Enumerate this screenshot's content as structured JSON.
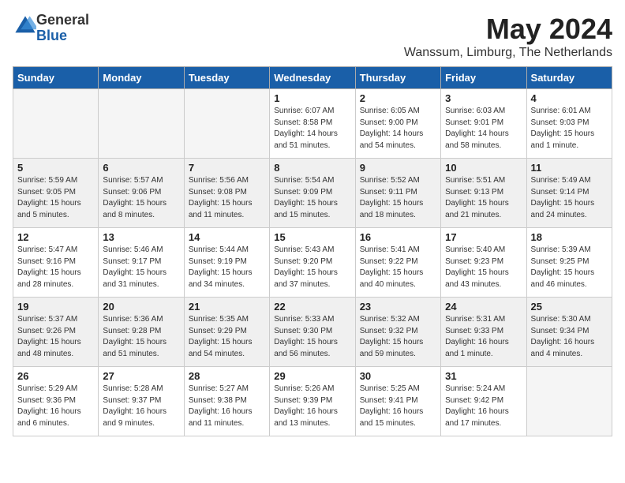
{
  "logo": {
    "general": "General",
    "blue": "Blue"
  },
  "header": {
    "month_title": "May 2024",
    "location": "Wanssum, Limburg, The Netherlands"
  },
  "weekdays": [
    "Sunday",
    "Monday",
    "Tuesday",
    "Wednesday",
    "Thursday",
    "Friday",
    "Saturday"
  ],
  "weeks": [
    [
      {
        "day": "",
        "info": ""
      },
      {
        "day": "",
        "info": ""
      },
      {
        "day": "",
        "info": ""
      },
      {
        "day": "1",
        "info": "Sunrise: 6:07 AM\nSunset: 8:58 PM\nDaylight: 14 hours\nand 51 minutes."
      },
      {
        "day": "2",
        "info": "Sunrise: 6:05 AM\nSunset: 9:00 PM\nDaylight: 14 hours\nand 54 minutes."
      },
      {
        "day": "3",
        "info": "Sunrise: 6:03 AM\nSunset: 9:01 PM\nDaylight: 14 hours\nand 58 minutes."
      },
      {
        "day": "4",
        "info": "Sunrise: 6:01 AM\nSunset: 9:03 PM\nDaylight: 15 hours\nand 1 minute."
      }
    ],
    [
      {
        "day": "5",
        "info": "Sunrise: 5:59 AM\nSunset: 9:05 PM\nDaylight: 15 hours\nand 5 minutes."
      },
      {
        "day": "6",
        "info": "Sunrise: 5:57 AM\nSunset: 9:06 PM\nDaylight: 15 hours\nand 8 minutes."
      },
      {
        "day": "7",
        "info": "Sunrise: 5:56 AM\nSunset: 9:08 PM\nDaylight: 15 hours\nand 11 minutes."
      },
      {
        "day": "8",
        "info": "Sunrise: 5:54 AM\nSunset: 9:09 PM\nDaylight: 15 hours\nand 15 minutes."
      },
      {
        "day": "9",
        "info": "Sunrise: 5:52 AM\nSunset: 9:11 PM\nDaylight: 15 hours\nand 18 minutes."
      },
      {
        "day": "10",
        "info": "Sunrise: 5:51 AM\nSunset: 9:13 PM\nDaylight: 15 hours\nand 21 minutes."
      },
      {
        "day": "11",
        "info": "Sunrise: 5:49 AM\nSunset: 9:14 PM\nDaylight: 15 hours\nand 24 minutes."
      }
    ],
    [
      {
        "day": "12",
        "info": "Sunrise: 5:47 AM\nSunset: 9:16 PM\nDaylight: 15 hours\nand 28 minutes."
      },
      {
        "day": "13",
        "info": "Sunrise: 5:46 AM\nSunset: 9:17 PM\nDaylight: 15 hours\nand 31 minutes."
      },
      {
        "day": "14",
        "info": "Sunrise: 5:44 AM\nSunset: 9:19 PM\nDaylight: 15 hours\nand 34 minutes."
      },
      {
        "day": "15",
        "info": "Sunrise: 5:43 AM\nSunset: 9:20 PM\nDaylight: 15 hours\nand 37 minutes."
      },
      {
        "day": "16",
        "info": "Sunrise: 5:41 AM\nSunset: 9:22 PM\nDaylight: 15 hours\nand 40 minutes."
      },
      {
        "day": "17",
        "info": "Sunrise: 5:40 AM\nSunset: 9:23 PM\nDaylight: 15 hours\nand 43 minutes."
      },
      {
        "day": "18",
        "info": "Sunrise: 5:39 AM\nSunset: 9:25 PM\nDaylight: 15 hours\nand 46 minutes."
      }
    ],
    [
      {
        "day": "19",
        "info": "Sunrise: 5:37 AM\nSunset: 9:26 PM\nDaylight: 15 hours\nand 48 minutes."
      },
      {
        "day": "20",
        "info": "Sunrise: 5:36 AM\nSunset: 9:28 PM\nDaylight: 15 hours\nand 51 minutes."
      },
      {
        "day": "21",
        "info": "Sunrise: 5:35 AM\nSunset: 9:29 PM\nDaylight: 15 hours\nand 54 minutes."
      },
      {
        "day": "22",
        "info": "Sunrise: 5:33 AM\nSunset: 9:30 PM\nDaylight: 15 hours\nand 56 minutes."
      },
      {
        "day": "23",
        "info": "Sunrise: 5:32 AM\nSunset: 9:32 PM\nDaylight: 15 hours\nand 59 minutes."
      },
      {
        "day": "24",
        "info": "Sunrise: 5:31 AM\nSunset: 9:33 PM\nDaylight: 16 hours\nand 1 minute."
      },
      {
        "day": "25",
        "info": "Sunrise: 5:30 AM\nSunset: 9:34 PM\nDaylight: 16 hours\nand 4 minutes."
      }
    ],
    [
      {
        "day": "26",
        "info": "Sunrise: 5:29 AM\nSunset: 9:36 PM\nDaylight: 16 hours\nand 6 minutes."
      },
      {
        "day": "27",
        "info": "Sunrise: 5:28 AM\nSunset: 9:37 PM\nDaylight: 16 hours\nand 9 minutes."
      },
      {
        "day": "28",
        "info": "Sunrise: 5:27 AM\nSunset: 9:38 PM\nDaylight: 16 hours\nand 11 minutes."
      },
      {
        "day": "29",
        "info": "Sunrise: 5:26 AM\nSunset: 9:39 PM\nDaylight: 16 hours\nand 13 minutes."
      },
      {
        "day": "30",
        "info": "Sunrise: 5:25 AM\nSunset: 9:41 PM\nDaylight: 16 hours\nand 15 minutes."
      },
      {
        "day": "31",
        "info": "Sunrise: 5:24 AM\nSunset: 9:42 PM\nDaylight: 16 hours\nand 17 minutes."
      },
      {
        "day": "",
        "info": ""
      }
    ]
  ]
}
